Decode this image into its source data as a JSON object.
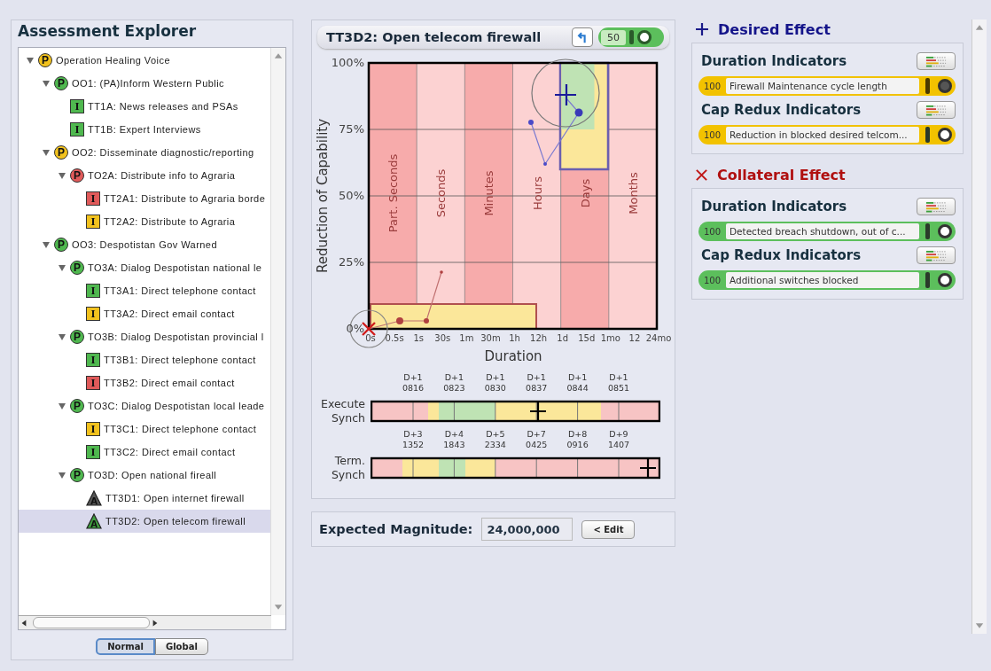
{
  "explorer": {
    "title": "Assessment Explorer",
    "tree": [
      {
        "kind": "circle",
        "badge": "P",
        "color": "#f2c21e",
        "label": "Operation Healing Voice",
        "expanded": true,
        "selected": false,
        "children": [
          {
            "kind": "circle",
            "badge": "P",
            "color": "#4fb84f",
            "label": "OO1: (PA)Inform Western Public",
            "expanded": true,
            "selected": false,
            "children": [
              {
                "kind": "square",
                "badge": "I",
                "color": "#4fb84f",
                "label": "TT1A: News releases and PSAs",
                "selected": false
              },
              {
                "kind": "square",
                "badge": "I",
                "color": "#4fb84f",
                "label": "TT1B: Expert Interviews",
                "selected": false
              }
            ]
          },
          {
            "kind": "circle",
            "badge": "P",
            "color": "#f2c21e",
            "label": "OO2: Disseminate diagnostic/reporting",
            "expanded": true,
            "selected": false,
            "children": [
              {
                "kind": "circle",
                "badge": "P",
                "color": "#e05a5a",
                "label": "TO2A: Distribute info to Agraria",
                "expanded": true,
                "selected": false,
                "children": [
                  {
                    "kind": "square",
                    "badge": "I",
                    "color": "#e05a5a",
                    "label": "TT2A1: Distribute to Agraria borde",
                    "selected": false
                  },
                  {
                    "kind": "square",
                    "badge": "I",
                    "color": "#f2c21e",
                    "label": "TT2A2: Distribute to Agraria",
                    "selected": false
                  }
                ]
              }
            ]
          },
          {
            "kind": "circle",
            "badge": "P",
            "color": "#4fb84f",
            "label": "OO3: Despotistan Gov Warned",
            "expanded": true,
            "selected": false,
            "children": [
              {
                "kind": "circle",
                "badge": "P",
                "color": "#4fb84f",
                "label": "TO3A: Dialog Despotistan national le",
                "expanded": true,
                "selected": false,
                "children": [
                  {
                    "kind": "square",
                    "badge": "I",
                    "color": "#4fb84f",
                    "label": "TT3A1: Direct telephone contact",
                    "selected": false
                  },
                  {
                    "kind": "square",
                    "badge": "I",
                    "color": "#f2c21e",
                    "label": "TT3A2: Direct email contact",
                    "selected": false
                  }
                ]
              },
              {
                "kind": "circle",
                "badge": "P",
                "color": "#4fb84f",
                "label": "TO3B: Dialog Despotistan provincial l",
                "expanded": true,
                "selected": false,
                "children": [
                  {
                    "kind": "square",
                    "badge": "I",
                    "color": "#4fb84f",
                    "label": "TT3B1: Direct telephone contact",
                    "selected": false
                  },
                  {
                    "kind": "square",
                    "badge": "I",
                    "color": "#e05a5a",
                    "label": "TT3B2: Direct email contact",
                    "selected": false
                  }
                ]
              },
              {
                "kind": "circle",
                "badge": "P",
                "color": "#4fb84f",
                "label": "TO3C: Dialog Despotistan local leade",
                "expanded": true,
                "selected": false,
                "children": [
                  {
                    "kind": "square",
                    "badge": "I",
                    "color": "#f2c21e",
                    "label": "TT3C1: Direct telephone contact",
                    "selected": false
                  },
                  {
                    "kind": "square",
                    "badge": "I",
                    "color": "#4fb84f",
                    "label": "TT3C2: Direct email contact",
                    "selected": false
                  }
                ]
              },
              {
                "kind": "circle",
                "badge": "P",
                "color": "#4fb84f",
                "label": "TO3D: Open national fireall",
                "expanded": true,
                "selected": false,
                "children": [
                  {
                    "kind": "triangle",
                    "badge": "A",
                    "color": "#555555",
                    "label": "TT3D1: Open internet firewall",
                    "selected": false
                  },
                  {
                    "kind": "triangle",
                    "badge": "A",
                    "color": "#3f9e3f",
                    "label": "TT3D2: Open telecom firewall",
                    "selected": true
                  }
                ]
              }
            ]
          }
        ]
      }
    ],
    "view_buttons": [
      {
        "label": "Normal",
        "selected": true
      },
      {
        "label": "Global",
        "selected": false
      }
    ]
  },
  "detail": {
    "title": "TT3D2: Open telecom firewall",
    "weight": "50",
    "chart": {
      "ylabel": "Reduction of Capability",
      "xlabel": "Duration",
      "yticks": [
        "100%",
        "75%",
        "50%",
        "25%",
        "0%"
      ],
      "xticks": [
        "0s",
        "0.5s",
        "1s",
        "30s",
        "1m",
        "30m",
        "1h",
        "12h",
        "1d",
        "15d",
        "1mo",
        "12",
        "24mo"
      ],
      "bands": [
        "Part. Seconds",
        "Seconds",
        "Minutes",
        "Hours",
        "Days",
        "Months"
      ]
    },
    "synch": [
      {
        "label": "Execute Synch",
        "ticks": [
          {
            "day": "D+1",
            "time": "0816"
          },
          {
            "day": "D+1",
            "time": "0823"
          },
          {
            "day": "D+1",
            "time": "0830"
          },
          {
            "day": "D+1",
            "time": "0837"
          },
          {
            "day": "D+1",
            "time": "0844"
          },
          {
            "day": "D+1",
            "time": "0851"
          }
        ]
      },
      {
        "label": "Term. Synch",
        "ticks": [
          {
            "day": "D+3",
            "time": "1352"
          },
          {
            "day": "D+4",
            "time": "1843"
          },
          {
            "day": "D+5",
            "time": "2334"
          },
          {
            "day": "D+7",
            "time": "0425"
          },
          {
            "day": "D+8",
            "time": "0916"
          },
          {
            "day": "D+9",
            "time": "1407"
          }
        ]
      }
    ]
  },
  "magnitude": {
    "label": "Expected Magnitude:",
    "value": "24,000,000",
    "button": "< Edit"
  },
  "effects": [
    {
      "kind": "desired",
      "title": "Desired Effect",
      "groups": [
        {
          "title": "Duration Indicators",
          "indicator": {
            "value": "100",
            "text": "Firewall Maintenance cycle length",
            "color": "#f2c200",
            "on": false
          }
        },
        {
          "title": "Cap Redux Indicators",
          "indicator": {
            "value": "100",
            "text": "Reduction in blocked desired telcom...",
            "color": "#f2c200",
            "on": true
          }
        }
      ]
    },
    {
      "kind": "collateral",
      "title": "Collateral Effect",
      "groups": [
        {
          "title": "Duration Indicators",
          "indicator": {
            "value": "100",
            "text": "Detected breach shutdown, out of c...",
            "color": "#5cbf5c",
            "on": true
          }
        },
        {
          "title": "Cap Redux Indicators",
          "indicator": {
            "value": "100",
            "text": "Additional switches blocked",
            "color": "#5cbf5c",
            "on": true
          }
        }
      ]
    }
  ]
}
